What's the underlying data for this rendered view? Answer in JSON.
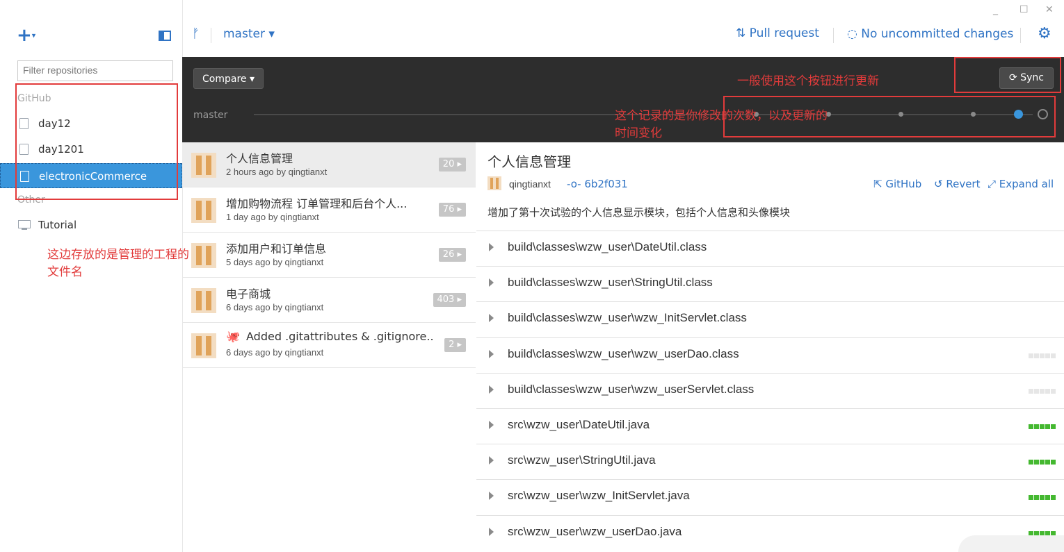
{
  "window": {
    "minimize": "_",
    "maximize": "☐",
    "close": "✕"
  },
  "sidebar": {
    "add_symbol": "+",
    "add_caret": "▾",
    "filter_placeholder": "Filter repositories",
    "groups": {
      "github": "GitHub",
      "other": "Other"
    },
    "repos": [
      {
        "name": "day12",
        "active": false
      },
      {
        "name": "day1201",
        "active": false
      },
      {
        "name": "electronicCommerce",
        "active": true
      }
    ],
    "other_repos": [
      {
        "name": "Tutorial"
      }
    ]
  },
  "topbar": {
    "branch": "master ▾",
    "pull_request": "Pull request",
    "uncommitted": "No uncommitted changes",
    "settings_icon": "gear-icon"
  },
  "history": {
    "compare_label": "Compare ▾",
    "sync_label": "Sync",
    "timeline_label": "master"
  },
  "commits": [
    {
      "title": "个人信息管理",
      "subtitle": "2 hours ago by qingtianxt",
      "count": "20 ▸",
      "selected": true
    },
    {
      "title": "增加购物流程 订单管理和后台个人...",
      "subtitle": "1 day ago by qingtianxt",
      "count": "76 ▸",
      "selected": false
    },
    {
      "title": "添加用户和订单信息",
      "subtitle": "5 days ago by qingtianxt",
      "count": "26 ▸",
      "selected": false
    },
    {
      "title": "电子商城",
      "subtitle": "6 days ago by qingtianxt",
      "count": "403 ▸",
      "selected": false
    },
    {
      "title": "Added .gitattributes & .gitignore...",
      "subtitle": "6 days ago by qingtianxt",
      "count": "2 ▸",
      "selected": false
    }
  ],
  "detail": {
    "title": "个人信息管理",
    "author": "qingtianxt",
    "sha": "6b2f031",
    "actions": {
      "github": "GitHub",
      "revert": "Revert",
      "expand": "Expand all"
    },
    "message": "增加了第十次试验的个人信息显示模块，包括个人信息和头像模块",
    "files": [
      {
        "name": "build\\classes\\wzw_user\\DateUtil.class",
        "diff": "none"
      },
      {
        "name": "build\\classes\\wzw_user\\StringUtil.class",
        "diff": "none"
      },
      {
        "name": "build\\classes\\wzw_user\\wzw_InitServlet.class",
        "diff": "none"
      },
      {
        "name": "build\\classes\\wzw_user\\wzw_userDao.class",
        "diff": "binary"
      },
      {
        "name": "build\\classes\\wzw_user\\wzw_userServlet.class",
        "diff": "binary"
      },
      {
        "name": "src\\wzw_user\\DateUtil.java",
        "diff": "added"
      },
      {
        "name": "src\\wzw_user\\StringUtil.java",
        "diff": "added"
      },
      {
        "name": "src\\wzw_user\\wzw_InitServlet.java",
        "diff": "added"
      },
      {
        "name": "src\\wzw_user\\wzw_userDao.java",
        "diff": "added"
      }
    ]
  },
  "annotations": {
    "sync_note": "一般使用这个按钮进行更新",
    "timeline_note_1": "这个记录的是你修改的次数，以及更新的",
    "timeline_note_2": "时间变化",
    "sidebar_note_1": "这边存放的是管理的工程的",
    "sidebar_note_2": "文件名"
  },
  "colors": {
    "accent": "#2f73c4",
    "selected_repo": "#3a96dc",
    "dark_band": "#2d2d2d",
    "annotation": "#e23b3b",
    "diff_added": "#44b830",
    "diff_binary": "#e6e6e6"
  }
}
